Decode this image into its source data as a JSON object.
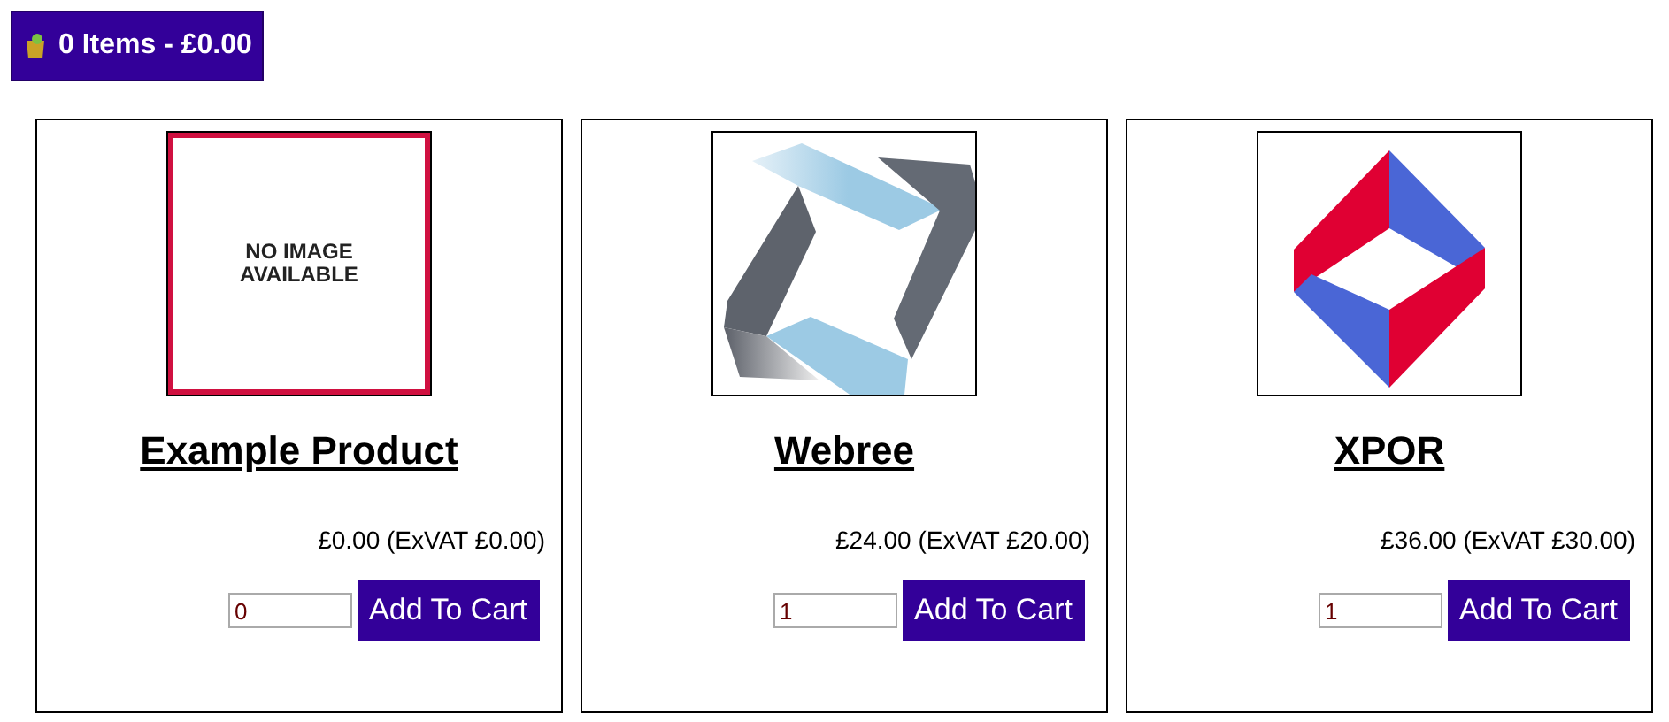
{
  "cart": {
    "label": "0 Items - £0.00"
  },
  "products": [
    {
      "name": "Example Product",
      "image": {
        "kind": "missing",
        "text": "NO IMAGE\nAVAILABLE"
      },
      "price": "£0.00 (ExVAT £0.00)",
      "quantity": "0",
      "button": "Add To Cart"
    },
    {
      "name": "Webree",
      "image": {
        "kind": "ribbon"
      },
      "price": "£24.00 (ExVAT £20.00)",
      "quantity": "1",
      "button": "Add To Cart"
    },
    {
      "name": "XPOR",
      "image": {
        "kind": "diamond"
      },
      "price": "£36.00 (ExVAT £30.00)",
      "quantity": "1",
      "button": "Add To Cart"
    }
  ]
}
